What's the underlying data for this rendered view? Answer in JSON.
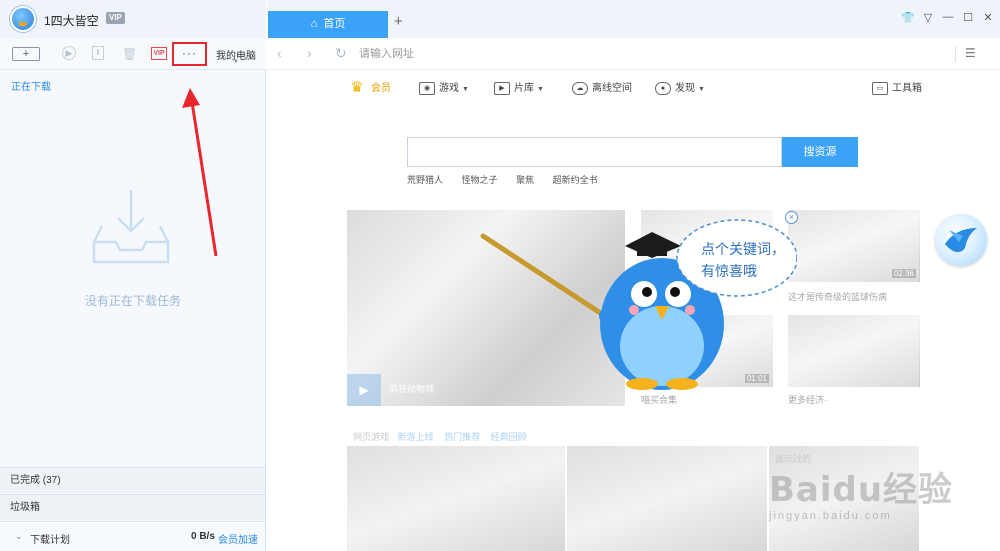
{
  "left": {
    "username": "1四大皆空",
    "vip_badge": "VIP",
    "toolbar": {
      "new_task_icon": "+",
      "vip_label": "VIP",
      "more_label": "···",
      "my_pc_label": "我的电脑"
    },
    "downloading_label": "正在下载",
    "empty_text": "没有正在下载任务",
    "completed_label": "已完成 (37)",
    "trash_label": "垃圾箱",
    "footer": {
      "plan_label": "下载计划",
      "speed": "0 B/s",
      "accelerate_label": "会员加速"
    }
  },
  "right": {
    "tab_home_label": "首页",
    "tab_add": "+",
    "address_placeholder": "请输入网址",
    "nav_menu": [
      {
        "label": "会员",
        "icon": "crown-icon"
      },
      {
        "label": "游戏",
        "icon": "game-icon"
      },
      {
        "label": "片库",
        "icon": "film-icon"
      },
      {
        "label": "离线空间",
        "icon": "cloud-icon"
      },
      {
        "label": "发现",
        "icon": "eye-icon"
      },
      {
        "label": "工具箱",
        "icon": "toolbox-icon"
      }
    ],
    "search_button": "搜资源",
    "hot_words": [
      "荒野猎人",
      "怪物之子",
      "聚焦",
      "超新约全书"
    ],
    "banner_caption": "疯狂动物城",
    "thumbs": [
      {
        "caption": "",
        "duration": ""
      },
      {
        "caption": "这才是传奇级的篮球伤病",
        "duration": "02:36"
      },
      {
        "caption": "喵买合集",
        "duration": "01:01"
      },
      {
        "caption": "更多经济·",
        "duration": ""
      }
    ],
    "games_header": {
      "title": "网页游戏",
      "tabs": [
        "新游上线",
        "热门推荐",
        "经典回顾"
      ]
    },
    "recent_label": "我玩过的",
    "mascot_bubble": {
      "line1": "点个关键词，",
      "line2": "有惊喜哦"
    },
    "watermark": {
      "main": "Baidu经验",
      "sub": "jingyan.baidu.com"
    }
  },
  "colors": {
    "accent": "#3aa2f7",
    "highlight_box": "#e8262e",
    "arrow": "#e8262e"
  }
}
